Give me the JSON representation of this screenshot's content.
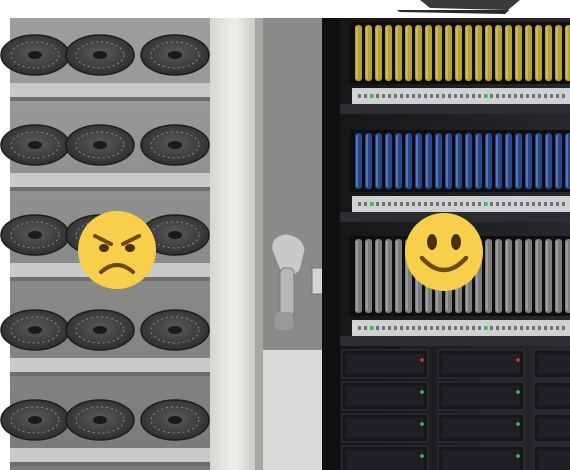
{
  "scene": {
    "left_shelf": {
      "reel_rows": 5,
      "reels_per_row": 3
    },
    "right_cabinet": {
      "reel_colors": [
        "#c9b23a",
        "#2a4c9c",
        "#8a8a8a"
      ],
      "drawer_columns": 3,
      "drawer_rows": 4
    },
    "emojis": [
      {
        "name": "angry-face-emoji",
        "expression": "angry"
      },
      {
        "name": "smiling-face-emoji",
        "expression": "smile"
      }
    ],
    "colors": {
      "emoji_fill": "#f7cf4a",
      "emoji_features": "#6b4a12",
      "shelf_light": "#c9c9c7",
      "cabinet_dark": "#1d1f22",
      "indicator_green": "#3cc45a",
      "indicator_red": "#d23b2f"
    }
  }
}
